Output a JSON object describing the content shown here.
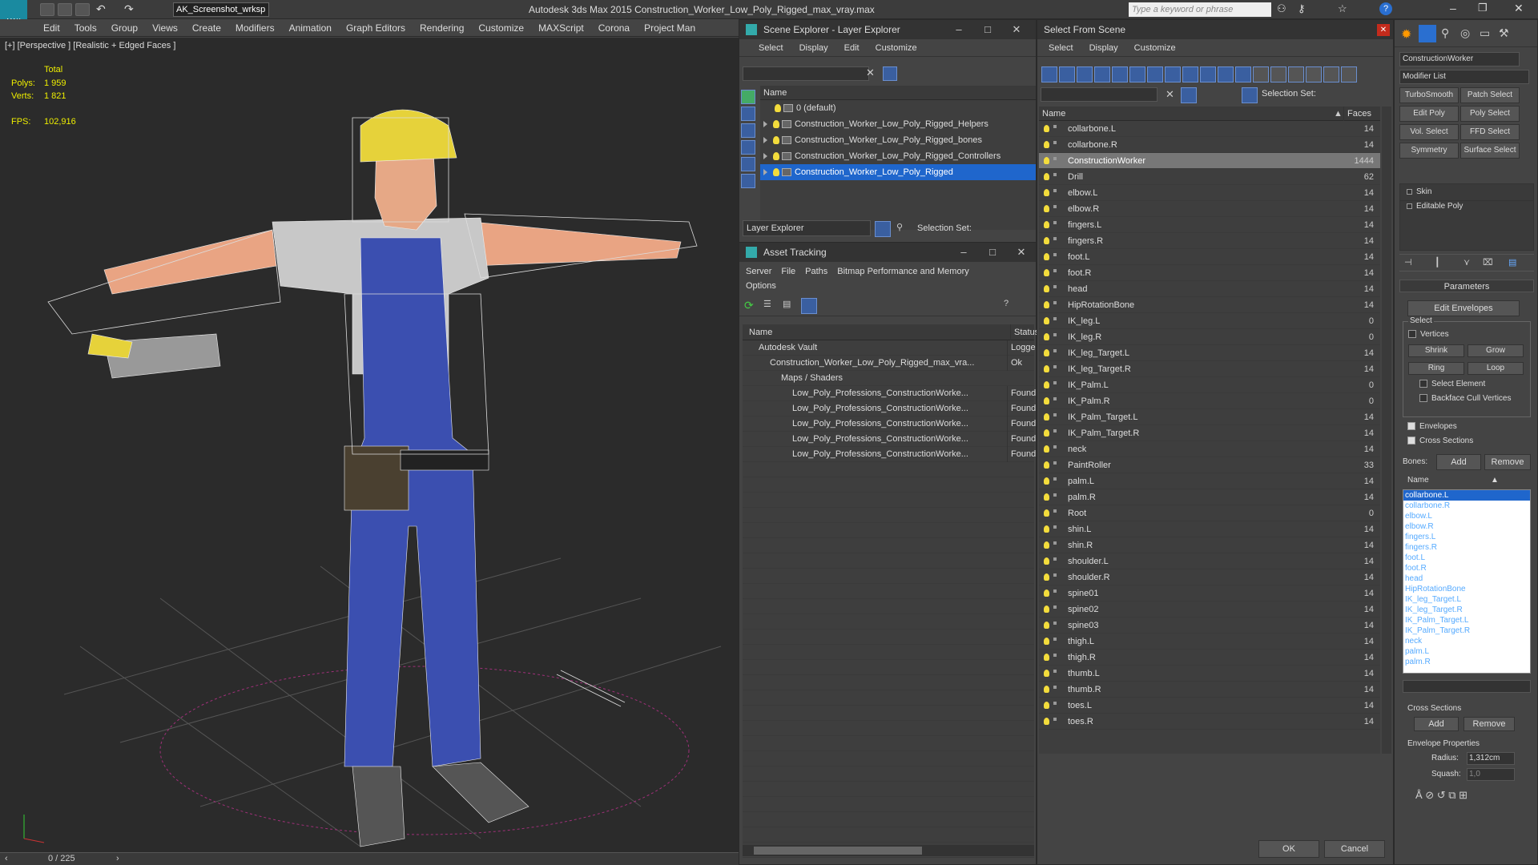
{
  "app": {
    "title": "Autodesk 3ds Max  2015    Construction_Worker_Low_Poly_Rigged_max_vray.max",
    "workspace": "AK_Screenshot_wrksp",
    "search_placeholder": "Type a keyword or phrase",
    "logo": "MAX"
  },
  "menu": [
    "Edit",
    "Tools",
    "Group",
    "Views",
    "Create",
    "Modifiers",
    "Animation",
    "Graph Editors",
    "Rendering",
    "Customize",
    "MAXScript",
    "Corona",
    "Project Man"
  ],
  "viewport": {
    "label": "[+] [Perspective ] [Realistic + Edged Faces ]",
    "total": "Total",
    "polys_label": "Polys:",
    "polys": "1 959",
    "verts_label": "Verts:",
    "verts": "1 821",
    "fps_label": "FPS:",
    "fps": "102,916"
  },
  "timeline": {
    "frame": "0 / 225"
  },
  "scene_explorer": {
    "title": "Scene Explorer - Layer Explorer",
    "menu": [
      "Select",
      "Display",
      "Edit",
      "Customize"
    ],
    "col": "Name",
    "layers": [
      "0 (default)",
      "Construction_Worker_Low_Poly_Rigged_Helpers",
      "Construction_Worker_Low_Poly_Rigged_bones",
      "Construction_Worker_Low_Poly_Rigged_Controllers",
      "Construction_Worker_Low_Poly_Rigged"
    ],
    "footer_combo": "Layer Explorer",
    "selection_set": "Selection Set:"
  },
  "asset_tracking": {
    "title": "Asset Tracking",
    "menu": [
      "Server",
      "File",
      "Paths",
      "Bitmap Performance and Memory"
    ],
    "menu2": "Options",
    "col_name": "Name",
    "col_status": "Status",
    "rows": [
      {
        "name": "Autodesk Vault",
        "status": "Logge"
      },
      {
        "name": "Construction_Worker_Low_Poly_Rigged_max_vra...",
        "status": "Ok"
      },
      {
        "name": "Maps / Shaders",
        "status": ""
      },
      {
        "name": "Low_Poly_Professions_ConstructionWorke...",
        "status": "Found"
      },
      {
        "name": "Low_Poly_Professions_ConstructionWorke...",
        "status": "Found"
      },
      {
        "name": "Low_Poly_Professions_ConstructionWorke...",
        "status": "Found"
      },
      {
        "name": "Low_Poly_Professions_ConstructionWorke...",
        "status": "Found"
      },
      {
        "name": "Low_Poly_Professions_ConstructionWorke...",
        "status": "Found"
      }
    ]
  },
  "select_from_scene": {
    "title": "Select From Scene",
    "menu": [
      "Select",
      "Display",
      "Customize"
    ],
    "selection_set": "Selection Set:",
    "col_name": "Name",
    "col_faces": "Faces",
    "ok": "OK",
    "cancel": "Cancel",
    "rows": [
      [
        "collarbone.L",
        "14"
      ],
      [
        "collarbone.R",
        "14"
      ],
      [
        "ConstructionWorker",
        "1444"
      ],
      [
        "Drill",
        "62"
      ],
      [
        "elbow.L",
        "14"
      ],
      [
        "elbow.R",
        "14"
      ],
      [
        "fingers.L",
        "14"
      ],
      [
        "fingers.R",
        "14"
      ],
      [
        "foot.L",
        "14"
      ],
      [
        "foot.R",
        "14"
      ],
      [
        "head",
        "14"
      ],
      [
        "HipRotationBone",
        "14"
      ],
      [
        "IK_leg.L",
        "0"
      ],
      [
        "IK_leg.R",
        "0"
      ],
      [
        "IK_leg_Target.L",
        "14"
      ],
      [
        "IK_leg_Target.R",
        "14"
      ],
      [
        "IK_Palm.L",
        "0"
      ],
      [
        "IK_Palm.R",
        "0"
      ],
      [
        "IK_Palm_Target.L",
        "14"
      ],
      [
        "IK_Palm_Target.R",
        "14"
      ],
      [
        "neck",
        "14"
      ],
      [
        "PaintRoller",
        "33"
      ],
      [
        "palm.L",
        "14"
      ],
      [
        "palm.R",
        "14"
      ],
      [
        "Root",
        "0"
      ],
      [
        "shin.L",
        "14"
      ],
      [
        "shin.R",
        "14"
      ],
      [
        "shoulder.L",
        "14"
      ],
      [
        "shoulder.R",
        "14"
      ],
      [
        "spine01",
        "14"
      ],
      [
        "spine02",
        "14"
      ],
      [
        "spine03",
        "14"
      ],
      [
        "thigh.L",
        "14"
      ],
      [
        "thigh.R",
        "14"
      ],
      [
        "thumb.L",
        "14"
      ],
      [
        "thumb.R",
        "14"
      ],
      [
        "toes.L",
        "14"
      ],
      [
        "toes.R",
        "14"
      ]
    ]
  },
  "command_panel": {
    "object_name": "ConstructionWorker",
    "modifier_list": "Modifier List",
    "buttons": [
      "TurboSmooth",
      "Patch Select",
      "Edit Poly",
      "Poly Select",
      "Vol. Select",
      "FFD Select",
      "Symmetry",
      "Surface Select"
    ],
    "stack": [
      "Skin",
      "Editable Poly"
    ],
    "params_title": "Parameters",
    "edit_envelopes": "Edit Envelopes",
    "select_label": "Select",
    "vertices": "Vertices",
    "shrink": "Shrink",
    "grow": "Grow",
    "ring": "Ring",
    "loop": "Loop",
    "select_element": "Select Element",
    "backface": "Backface Cull Vertices",
    "envelopes": "Envelopes",
    "cross_sections": "Cross Sections",
    "bones_label": "Bones:",
    "add": "Add",
    "remove": "Remove",
    "name_col": "Name",
    "bones": [
      "collarbone.L",
      "collarbone.R",
      "elbow.L",
      "elbow.R",
      "fingers.L",
      "fingers.R",
      "foot.L",
      "foot.R",
      "head",
      "HipRotationBone",
      "IK_leg_Target.L",
      "IK_leg_Target.R",
      "IK_Palm_Target.L",
      "IK_Palm_Target.R",
      "neck",
      "palm.L",
      "palm.R"
    ],
    "cross_sections_title": "Cross Sections",
    "env_props": "Envelope Properties",
    "radius_label": "Radius:",
    "radius": "1,312cm",
    "squash_label": "Squash:",
    "squash": "1,0"
  },
  "colors": {
    "accent": "#1f66cc",
    "bulb": "#f3dc3c",
    "helmet": "#e6d23a",
    "overalls": "#3b4fb0"
  }
}
